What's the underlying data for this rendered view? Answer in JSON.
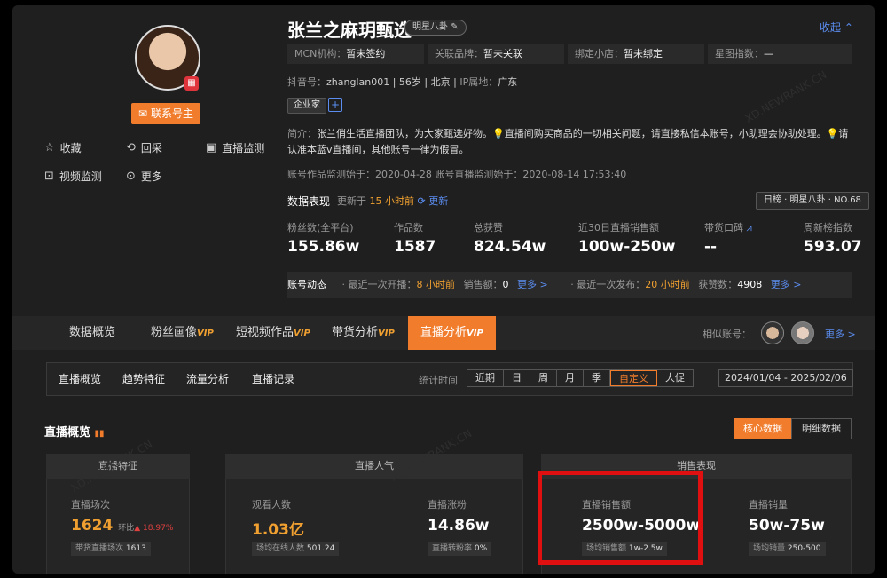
{
  "profile": {
    "name": "张兰之麻玥甄选",
    "tag": "明星八卦",
    "collapse": "收起",
    "contact": "联系号主",
    "actions": {
      "fav": "收藏",
      "back": "回采",
      "live_monitor": "直播监测",
      "video_monitor": "视频监测",
      "more": "更多"
    },
    "info": [
      {
        "label": "MCN机构：",
        "value": "暂未签约"
      },
      {
        "label": "关联品牌：",
        "value": "暂未关联"
      },
      {
        "label": "绑定小店：",
        "value": "暂未绑定"
      },
      {
        "label": "星图指数：",
        "value": "—"
      }
    ],
    "douyin_label": "抖音号：",
    "douyin_id": "zhanglan001",
    "age": "56岁",
    "city": "北京",
    "ip_label": "IP属地：",
    "ip": "广东",
    "enterprise": "企业家",
    "bio_label": "简介：",
    "bio": "张兰俏生活直播团队，为大家甄选好物。💡直播间购买商品的一切相关问题，请直接私信本账号，小助理会协助处理。💡请认准本蓝v直播间，其他账号一律为假冒。",
    "since": "账号作品监测始于：2020-04-28   账号直播监测始于：2020-08-14 17:53:40"
  },
  "perf": {
    "title": "数据表现",
    "updated_pre": "更新于",
    "updated_time": "15 小时前",
    "refresh": "更新",
    "rank": "日榜 · 明星八卦 · NO.68",
    "stats": [
      {
        "label": "粉丝数(全平台)",
        "value": "155.86w"
      },
      {
        "label": "作品数",
        "value": "1587"
      },
      {
        "label": "总获赞",
        "value": "824.54w"
      },
      {
        "label": "近30日直播销售额",
        "value": "100w-250w"
      },
      {
        "label": "带货口碑",
        "value": "--"
      },
      {
        "label": "周新榜指数",
        "value": "593.07"
      }
    ]
  },
  "dynamic": {
    "label": "账号动态",
    "live_pre": "最近一次开播：",
    "live_time": "8 小时前",
    "sales_label": "销售额：",
    "sales_value": "0",
    "more1": "更多 >",
    "pub_pre": "最近一次发布：",
    "pub_time": "20 小时前",
    "likes_label": "获赞数：",
    "likes_value": "4908",
    "more2": "更多 >"
  },
  "tabs": [
    {
      "label": "数据概览",
      "vip": ""
    },
    {
      "label": "粉丝画像",
      "vip": "VIP"
    },
    {
      "label": "短视频作品",
      "vip": "VIP"
    },
    {
      "label": "带货分析",
      "vip": "VIP"
    },
    {
      "label": "直播分析",
      "vip": "VIP"
    }
  ],
  "similar": {
    "label": "相似账号：",
    "more": "更多 >"
  },
  "subtabs": [
    "直播概览",
    "趋势特征",
    "流量分析",
    "直播记录"
  ],
  "stat_time": "统计时间",
  "periods": [
    "近期",
    "日",
    "周",
    "月",
    "季",
    "自定义",
    "大促"
  ],
  "selected_period": "自定义",
  "date_range": "2024/01/04 - 2025/02/06",
  "overview": {
    "title": "直播概览",
    "core": "核心数据",
    "detail": "明细数据"
  },
  "cards": {
    "feature": "直播特征",
    "popularity": "直播人气",
    "sales": "销售表现"
  },
  "metrics": {
    "sessions_label": "直播场次",
    "sessions_value": "1624",
    "ring_label": "环比",
    "ring_value": "▲ 18.97%",
    "goods_sessions_label": "带货直播场次",
    "goods_sessions_value": "1613",
    "viewers_label": "观看人数",
    "viewers_value": "1.03亿",
    "avg_online_label": "场均在线人数",
    "avg_online_value": "501.24",
    "fans_label": "直播涨粉",
    "fans_value": "14.86w",
    "fans_rate_label": "直播转粉率",
    "fans_rate_value": "0%",
    "gmv_label": "直播销售额",
    "gmv_value": "2500w-5000w",
    "avg_gmv_label": "场均销售额",
    "avg_gmv_value": "1w-2.5w",
    "volume_label": "直播销量",
    "volume_value": "50w-75w",
    "avg_volume_label": "场均销量",
    "avg_volume_value": "250-500"
  },
  "watermark": "XD.NEWRANK.CN",
  "colors": {
    "accent": "#f07c2c",
    "link": "#5b8df0",
    "highlight": "#e01010"
  }
}
